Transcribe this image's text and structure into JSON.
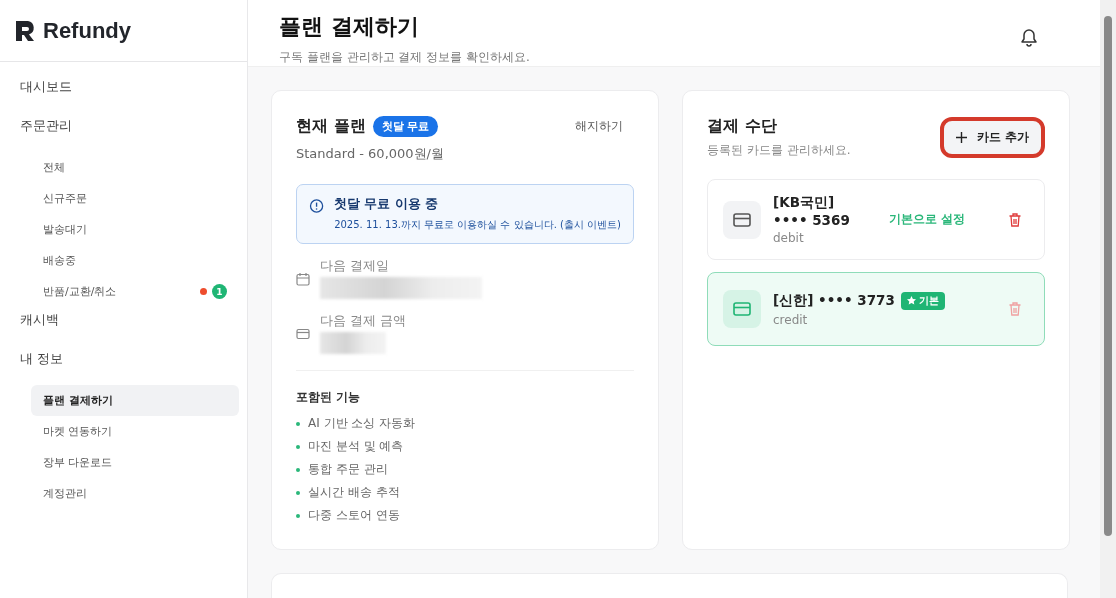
{
  "sidebar": {
    "logo": "Refundy",
    "items": [
      {
        "label": "대시보드",
        "selected": false
      },
      {
        "label": "주문관리",
        "selected": false,
        "children": [
          {
            "label": "전체",
            "selected": false
          },
          {
            "label": "신규주문",
            "selected": false
          },
          {
            "label": "발송대기",
            "selected": false
          },
          {
            "label": "배송중",
            "selected": false
          },
          {
            "label": "반품/교환/취소",
            "selected": false,
            "dot": true,
            "badge": "1"
          }
        ]
      },
      {
        "label": "캐시백",
        "selected": false
      },
      {
        "label": "내 정보",
        "selected": false,
        "children": [
          {
            "label": "플랜 결제하기",
            "selected": true
          },
          {
            "label": "마켓 연동하기",
            "selected": false
          },
          {
            "label": "장부 다운로드",
            "selected": false
          },
          {
            "label": "계정관리",
            "selected": false
          }
        ]
      }
    ]
  },
  "header": {
    "title": "플랜 결제하기",
    "subtitle": "구독 플랜을 관리하고 결제 정보를 확인하세요."
  },
  "plan": {
    "title": "현재 플랜",
    "badge": "첫달 무료",
    "cancel": "해지하기",
    "price": "Standard - 60,000원/월",
    "notice": {
      "title": "첫달 무료 이용 중",
      "text": "2025. 11. 13.까지 무료로 이용하실 수 있습니다. (출시 이벤트)"
    },
    "details": [
      {
        "kind": "calendar",
        "label": "다음 결제일",
        "redacted": true
      },
      {
        "kind": "card",
        "label": "다음 결제 금액",
        "redacted": true
      }
    ],
    "features_title": "포함된 기능",
    "features": [
      "AI 기반 소싱 자동화",
      "마진 분석 및 예측",
      "통합 주문 관리",
      "실시간 배송 추적",
      "다중 스토어 연동"
    ]
  },
  "payment": {
    "title": "결제 수단",
    "subtitle": "등록된 카드를 관리하세요.",
    "add_button": {
      "label": "카드 추가",
      "highlighted": true
    },
    "cards": [
      {
        "name": "[KB국민] •••• 5369",
        "type": "debit",
        "selected": false,
        "set_default": "기본으로 설정"
      },
      {
        "name": "[신한] •••• 3773",
        "type": "credit",
        "selected": true,
        "default_badge": "기본"
      }
    ]
  }
}
